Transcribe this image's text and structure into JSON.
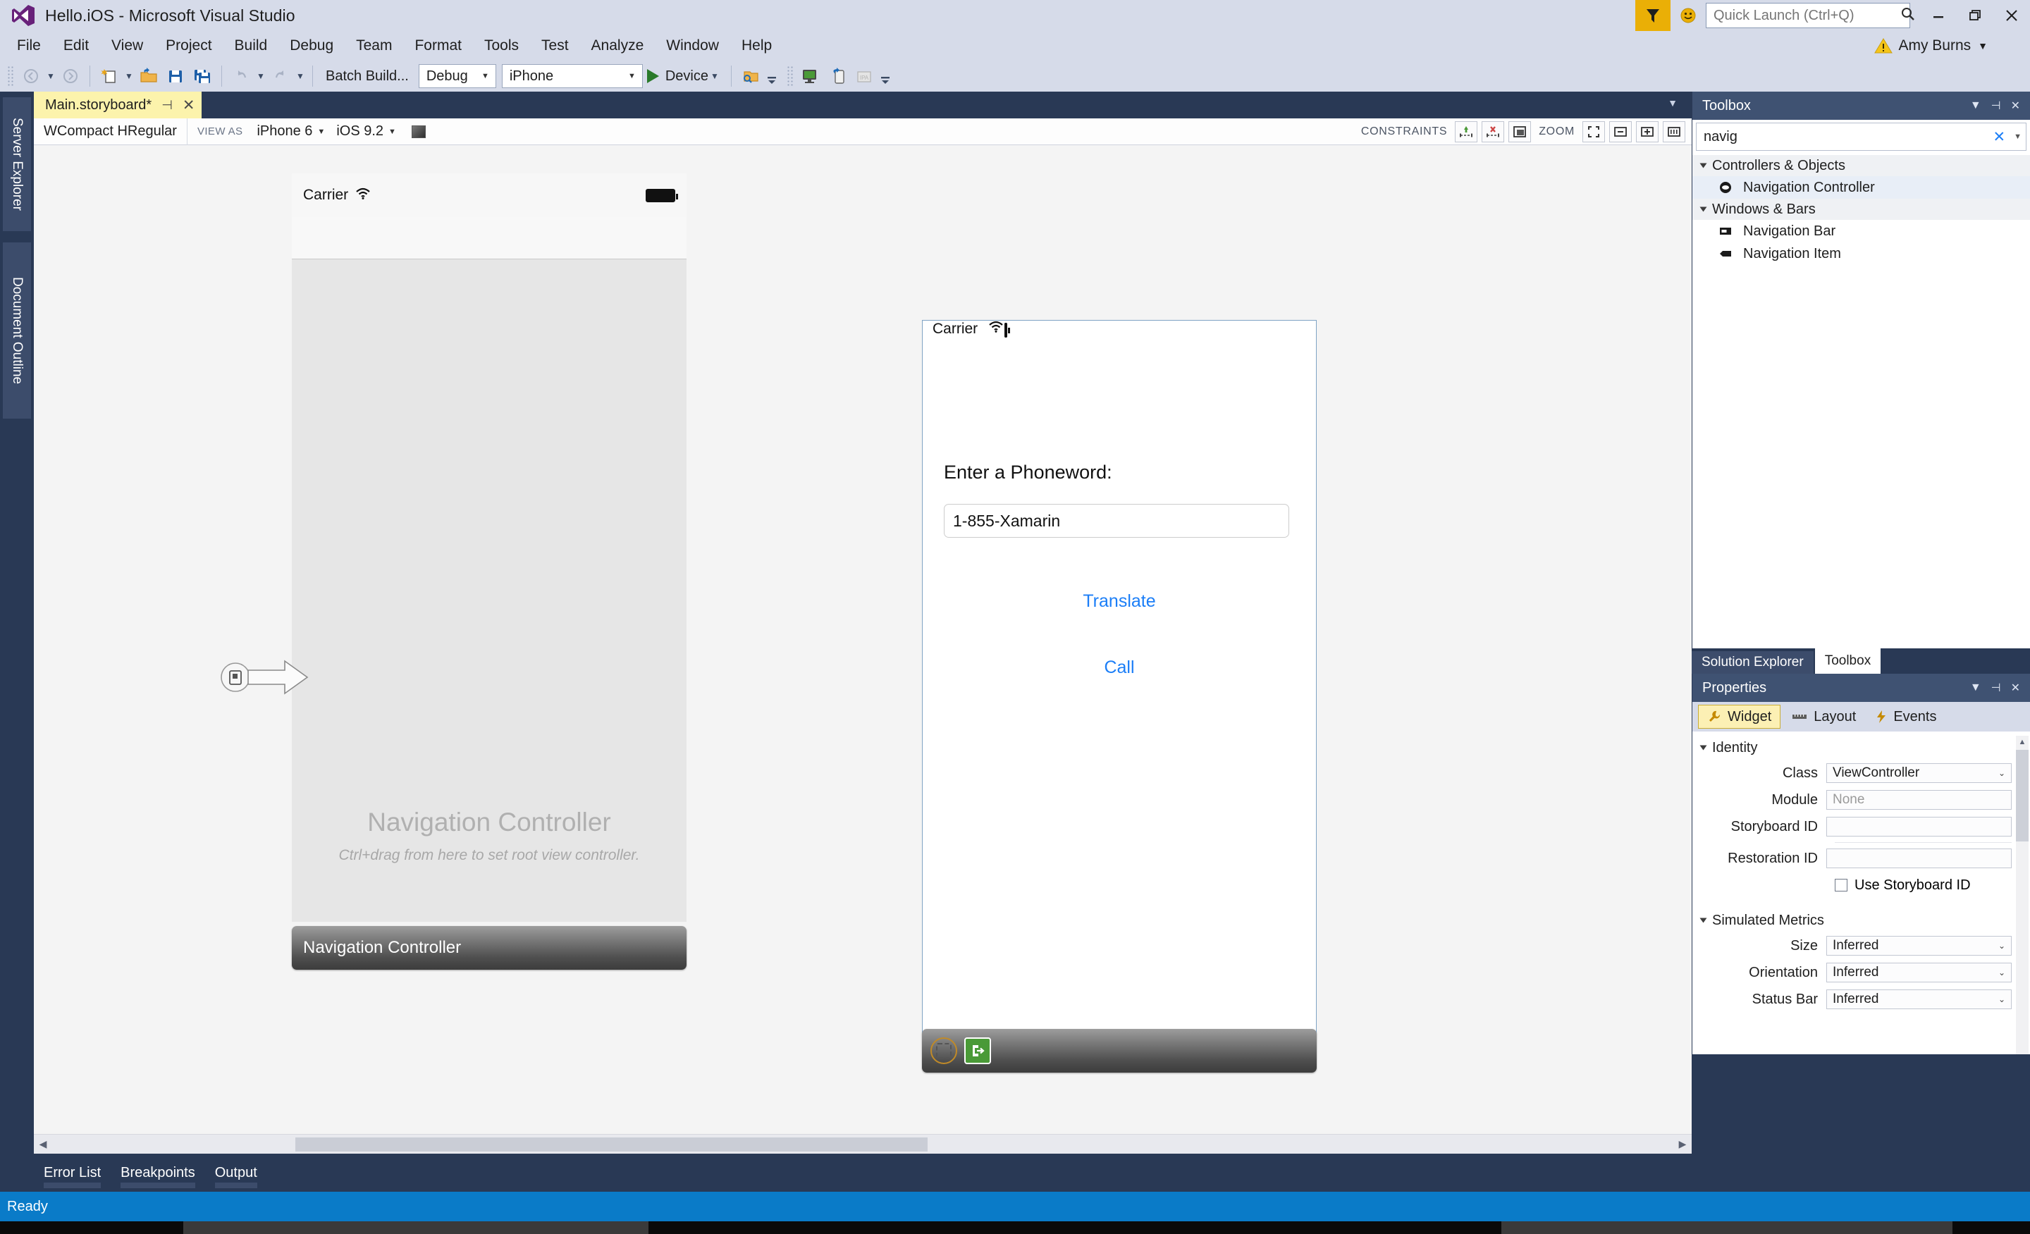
{
  "window": {
    "title": "Hello.iOS - Microsoft Visual Studio",
    "quick_launch_placeholder": "Quick Launch (Ctrl+Q)",
    "account_name": "Amy Burns",
    "minimize_label": "Minimize",
    "restore_label": "Restore Down",
    "close_label": "Close",
    "feedback_label": "Send Feedback",
    "smiley_label": "Feedback Smiley"
  },
  "menu": {
    "items": [
      {
        "label": "File"
      },
      {
        "label": "Edit"
      },
      {
        "label": "View"
      },
      {
        "label": "Project"
      },
      {
        "label": "Build"
      },
      {
        "label": "Debug"
      },
      {
        "label": "Team"
      },
      {
        "label": "Format"
      },
      {
        "label": "Tools"
      },
      {
        "label": "Test"
      },
      {
        "label": "Analyze"
      },
      {
        "label": "Window"
      },
      {
        "label": "Help"
      }
    ]
  },
  "toolbar": {
    "batch_build_label": "Batch Build...",
    "configuration": "Debug",
    "platform": "iPhone",
    "run_target": "Device"
  },
  "left_rail": {
    "tabs": [
      {
        "label": "Server Explorer"
      },
      {
        "label": "Document Outline"
      }
    ]
  },
  "document_tabs": {
    "active_tab": "Main.storyboard*"
  },
  "storyboard_toolbar": {
    "size_class_w": "WCompact",
    "size_class_h": "HRegular",
    "view_as_label": "VIEW AS",
    "device": "iPhone 6",
    "os_version": "iOS 9.2",
    "constraints_label": "CONSTRAINTS",
    "zoom_label": "ZOOM"
  },
  "canvas": {
    "device1": {
      "carrier": "Carrier",
      "placeholder_title": "Navigation Controller",
      "placeholder_subtitle": "Ctrl+drag from here to set root view controller.",
      "footer_label": "Navigation Controller"
    },
    "device2": {
      "carrier": "Carrier",
      "prompt_label": "Enter a Phoneword:",
      "phone_input_value": "1-855-Xamarin",
      "translate_button": "Translate",
      "call_button": "Call"
    }
  },
  "toolbox": {
    "title": "Toolbox",
    "search_value": "navig",
    "groups": [
      {
        "label": "Controllers & Objects",
        "items": [
          {
            "label": "Navigation Controller",
            "icon": "navigation-controller-icon"
          }
        ]
      },
      {
        "label": "Windows & Bars",
        "items": [
          {
            "label": "Navigation Bar",
            "icon": "navigation-bar-icon"
          },
          {
            "label": "Navigation Item",
            "icon": "navigation-item-icon"
          }
        ]
      }
    ]
  },
  "panel_tabs": [
    {
      "label": "Solution Explorer",
      "active": false
    },
    {
      "label": "Toolbox",
      "active": true
    }
  ],
  "properties": {
    "title": "Properties",
    "tabs": [
      {
        "label": "Widget",
        "icon": "wrench-icon",
        "active": true
      },
      {
        "label": "Layout",
        "icon": "ruler-icon",
        "active": false
      },
      {
        "label": "Events",
        "icon": "lightning-icon",
        "active": false
      }
    ],
    "sections": [
      {
        "label": "Identity",
        "rows": [
          {
            "label": "Class",
            "value": "ViewController",
            "type": "select"
          },
          {
            "label": "Module",
            "value": "None",
            "type": "placeholder"
          },
          {
            "label": "Storyboard ID",
            "value": "",
            "type": "text"
          },
          {
            "label": "Restoration ID",
            "value": "",
            "type": "text"
          }
        ],
        "checkbox": {
          "label": "Use Storyboard ID",
          "checked": false
        }
      },
      {
        "label": "Simulated Metrics",
        "rows": [
          {
            "label": "Size",
            "value": "Inferred",
            "type": "select"
          },
          {
            "label": "Orientation",
            "value": "Inferred",
            "type": "select"
          },
          {
            "label": "Status Bar",
            "value": "Inferred",
            "type": "select"
          }
        ]
      }
    ]
  },
  "bottom_tabs": [
    {
      "label": "Error List"
    },
    {
      "label": "Breakpoints"
    },
    {
      "label": "Output"
    }
  ],
  "status_bar": {
    "text": "Ready",
    "color": "#0a7bc8"
  },
  "colors": {
    "chrome": "#d6dbe9",
    "panel_header": "#3f5272",
    "dark_shell": "#293955",
    "accent_yellow": "#fcf3ac",
    "ios_blue": "#1b7ef7",
    "status_blue": "#0a7bc8"
  }
}
